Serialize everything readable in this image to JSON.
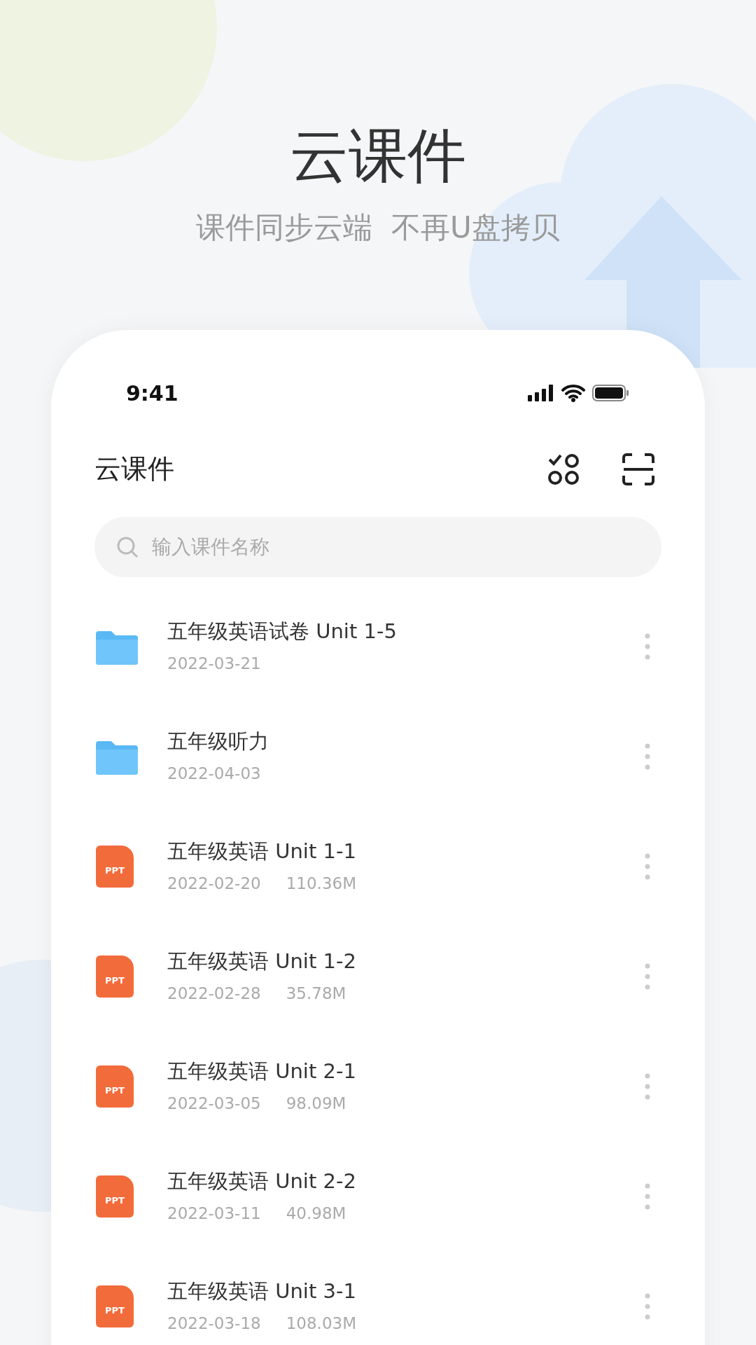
{
  "hero": {
    "title": "云课件",
    "subtitle": "课件同步云端  不再U盘拷贝"
  },
  "status_bar": {
    "time": "9:41"
  },
  "header": {
    "title": "云课件"
  },
  "search": {
    "placeholder": "输入课件名称"
  },
  "files": [
    {
      "kind": "folder",
      "name": "五年级英语试卷 Unit 1-5",
      "date": "2022-03-21"
    },
    {
      "kind": "folder",
      "name": "五年级听力",
      "date": "2022-04-03"
    },
    {
      "kind": "ppt",
      "badge": "PPT",
      "name": "五年级英语 Unit 1-1",
      "date": "2022-02-20",
      "size": "110.36M"
    },
    {
      "kind": "ppt",
      "badge": "PPT",
      "name": "五年级英语 Unit 1-2",
      "date": "2022-02-28",
      "size": "35.78M"
    },
    {
      "kind": "ppt",
      "badge": "PPT",
      "name": "五年级英语 Unit 2-1",
      "date": "2022-03-05",
      "size": "98.09M"
    },
    {
      "kind": "ppt",
      "badge": "PPT",
      "name": "五年级英语 Unit 2-2",
      "date": "2022-03-11",
      "size": "40.98M"
    },
    {
      "kind": "ppt",
      "badge": "PPT",
      "name": "五年级英语 Unit 3-1",
      "date": "2022-03-18",
      "size": "108.03M"
    }
  ]
}
